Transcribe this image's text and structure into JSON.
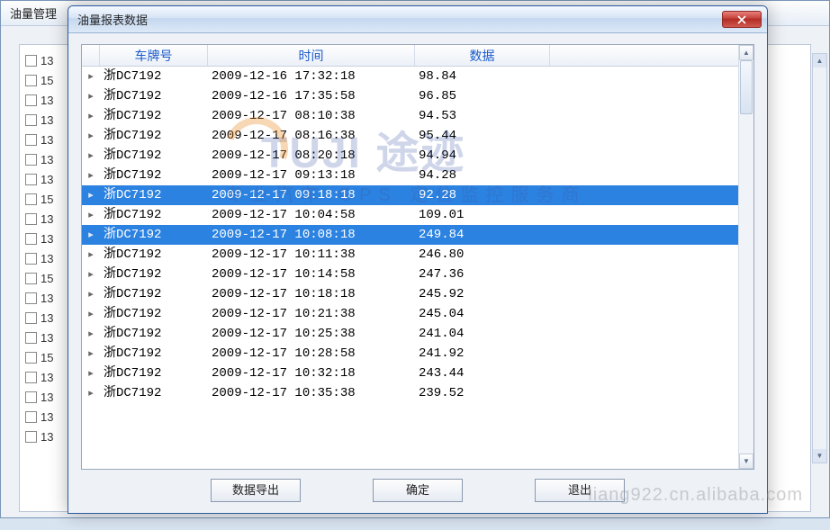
{
  "outer": {
    "title": "油量管理",
    "bg_rows": [
      "13",
      "15",
      "13",
      "13",
      "13",
      "13",
      "13",
      "15",
      "13",
      "13",
      "13",
      "15",
      "13",
      "13",
      "13",
      "15",
      "13",
      "13",
      "13",
      "13"
    ]
  },
  "dialog": {
    "title": "油量报表数据",
    "columns": {
      "plate": "车牌号",
      "time": "时间",
      "data": "数据"
    },
    "buttons": {
      "export": "数据导出",
      "ok": "确定",
      "exit": "退出"
    }
  },
  "rows": [
    {
      "plate": "浙DC7192",
      "time": "2009-12-16 17:32:18",
      "data": "98.84",
      "sel": false
    },
    {
      "plate": "浙DC7192",
      "time": "2009-12-16 17:35:58",
      "data": "96.85",
      "sel": false
    },
    {
      "plate": "浙DC7192",
      "time": "2009-12-17 08:10:38",
      "data": "94.53",
      "sel": false
    },
    {
      "plate": "浙DC7192",
      "time": "2009-12-17 08:16:38",
      "data": "95.44",
      "sel": false
    },
    {
      "plate": "浙DC7192",
      "time": "2009-12-17 08:20:18",
      "data": "94.94",
      "sel": false
    },
    {
      "plate": "浙DC7192",
      "time": "2009-12-17 09:13:18",
      "data": "94.28",
      "sel": false
    },
    {
      "plate": "浙DC7192",
      "time": "2009-12-17 09:18:18",
      "data": "92.28",
      "sel": true
    },
    {
      "plate": "浙DC7192",
      "time": "2009-12-17 10:04:58",
      "data": "109.01",
      "sel": false
    },
    {
      "plate": "浙DC7192",
      "time": "2009-12-17 10:08:18",
      "data": "249.84",
      "sel": true
    },
    {
      "plate": "浙DC7192",
      "time": "2009-12-17 10:11:38",
      "data": "246.80",
      "sel": false
    },
    {
      "plate": "浙DC7192",
      "time": "2009-12-17 10:14:58",
      "data": "247.36",
      "sel": false
    },
    {
      "plate": "浙DC7192",
      "time": "2009-12-17 10:18:18",
      "data": "245.92",
      "sel": false
    },
    {
      "plate": "浙DC7192",
      "time": "2009-12-17 10:21:38",
      "data": "245.04",
      "sel": false
    },
    {
      "plate": "浙DC7192",
      "time": "2009-12-17 10:25:38",
      "data": "241.04",
      "sel": false
    },
    {
      "plate": "浙DC7192",
      "time": "2009-12-17 10:28:58",
      "data": "241.92",
      "sel": false
    },
    {
      "plate": "浙DC7192",
      "time": "2009-12-17 10:32:18",
      "data": "243.44",
      "sel": false
    },
    {
      "plate": "浙DC7192",
      "time": "2009-12-17 10:35:38",
      "data": "239.52",
      "sel": false
    }
  ],
  "watermark": {
    "brand": "TUJI 途迹",
    "tagline": "专业汽车 GPS 定位监控服务商",
    "site": "liang922.cn.alibaba.com"
  }
}
